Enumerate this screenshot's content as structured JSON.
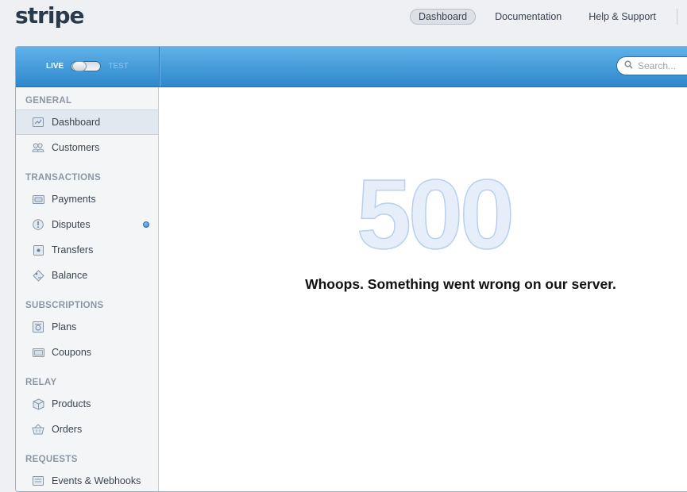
{
  "brand": {
    "logo": "stripe"
  },
  "topnav": {
    "items": [
      {
        "label": "Dashboard",
        "active": true
      },
      {
        "label": "Documentation",
        "active": false
      },
      {
        "label": "Help & Support",
        "active": false
      }
    ]
  },
  "topbar": {
    "mode_live": "LIVE",
    "mode_test": "TEST",
    "search_placeholder": "Search..."
  },
  "sidebar": {
    "sections": [
      {
        "title": "GENERAL",
        "items": [
          {
            "label": "Dashboard",
            "icon": "dashboard-icon",
            "active": true
          },
          {
            "label": "Customers",
            "icon": "customers-icon"
          }
        ]
      },
      {
        "title": "TRANSACTIONS",
        "items": [
          {
            "label": "Payments",
            "icon": "payments-icon"
          },
          {
            "label": "Disputes",
            "icon": "disputes-icon",
            "indicator": true
          },
          {
            "label": "Transfers",
            "icon": "transfers-icon"
          },
          {
            "label": "Balance",
            "icon": "balance-icon"
          }
        ]
      },
      {
        "title": "SUBSCRIPTIONS",
        "items": [
          {
            "label": "Plans",
            "icon": "plans-icon"
          },
          {
            "label": "Coupons",
            "icon": "coupons-icon"
          }
        ]
      },
      {
        "title": "RELAY",
        "items": [
          {
            "label": "Products",
            "icon": "products-icon"
          },
          {
            "label": "Orders",
            "icon": "orders-icon"
          }
        ]
      },
      {
        "title": "REQUESTS",
        "items": [
          {
            "label": "Events & Webhooks",
            "icon": "events-icon"
          }
        ]
      }
    ]
  },
  "main": {
    "error_code": "500",
    "error_message": "Whoops. Something went wrong on our server."
  },
  "colors": {
    "accent": "#2f88cc",
    "indicator": "#3b7fcf"
  }
}
